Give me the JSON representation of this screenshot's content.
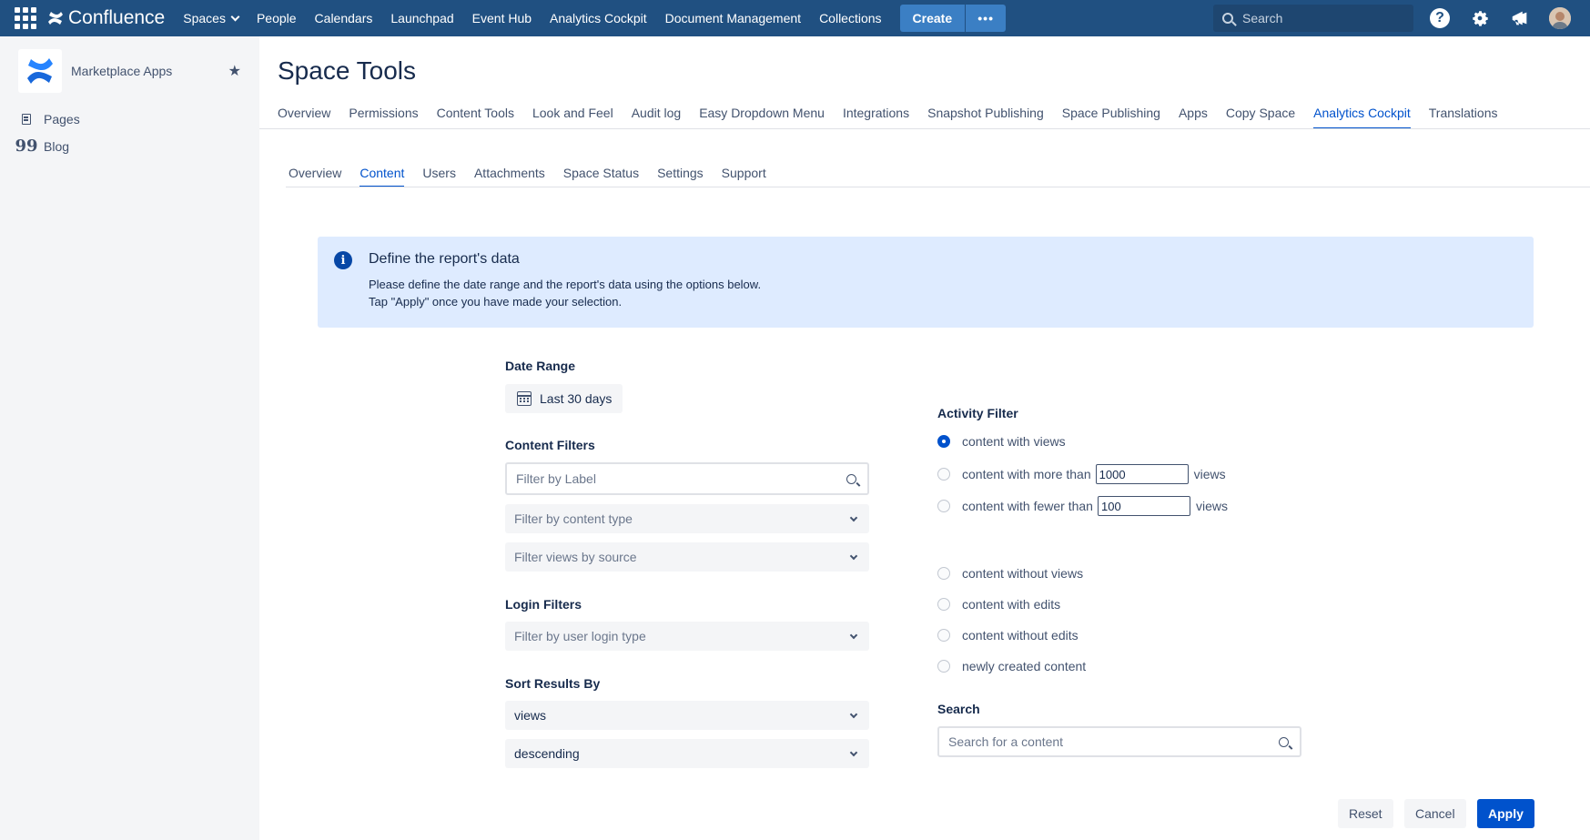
{
  "topnav": {
    "brand": "Confluence",
    "items": [
      "Spaces",
      "People",
      "Calendars",
      "Launchpad",
      "Event Hub",
      "Analytics Cockpit",
      "Document Management",
      "Collections"
    ],
    "create_label": "Create",
    "more_label": "•••",
    "search_placeholder": "Search",
    "help_label": "?"
  },
  "sidebar": {
    "space_name": "Marketplace Apps",
    "links": [
      {
        "label": "Pages",
        "icon": "page-icon"
      },
      {
        "label": "Blog",
        "icon": "quote-icon"
      }
    ]
  },
  "main": {
    "title": "Space Tools",
    "tabs": [
      "Overview",
      "Permissions",
      "Content Tools",
      "Look and Feel",
      "Audit log",
      "Easy Dropdown Menu",
      "Integrations",
      "Snapshot Publishing",
      "Space Publishing",
      "Apps",
      "Copy Space",
      "Analytics Cockpit",
      "Translations"
    ],
    "active_tab": "Analytics Cockpit",
    "subtabs": [
      "Overview",
      "Content",
      "Users",
      "Attachments",
      "Space Status",
      "Settings",
      "Support"
    ],
    "active_subtab": "Content"
  },
  "info": {
    "icon": "i",
    "title": "Define the report's data",
    "line1": "Please define the date range and the report's data using the options below.",
    "line2": "Tap \"Apply\" once you have made your selection."
  },
  "form": {
    "date_range_label": "Date Range",
    "date_range_value": "Last 30 days",
    "content_filters_label": "Content Filters",
    "filter_label_placeholder": "Filter by Label",
    "filter_content_type": "Filter by content type",
    "filter_views_source": "Filter views by source",
    "login_filters_label": "Login Filters",
    "filter_login_type": "Filter by user login type",
    "sort_label": "Sort Results By",
    "sort_field": "views",
    "sort_order": "descending",
    "activity_label": "Activity Filter",
    "activity_options": [
      {
        "label": "content with views",
        "checked": true
      },
      {
        "label": "content with more than",
        "input": "1000",
        "suffix": "views"
      },
      {
        "label": "content with fewer than",
        "input": "100",
        "suffix": "views"
      },
      {
        "label": "content without views"
      },
      {
        "label": "content with edits"
      },
      {
        "label": "content without edits"
      },
      {
        "label": "newly created content"
      }
    ],
    "search_label": "Search",
    "search_placeholder": "Search for a content"
  },
  "actions": {
    "reset": "Reset",
    "cancel": "Cancel",
    "apply": "Apply"
  },
  "colors": {
    "nav_bg": "#205081",
    "accent": "#0052cc",
    "info_bg": "#deebff"
  }
}
